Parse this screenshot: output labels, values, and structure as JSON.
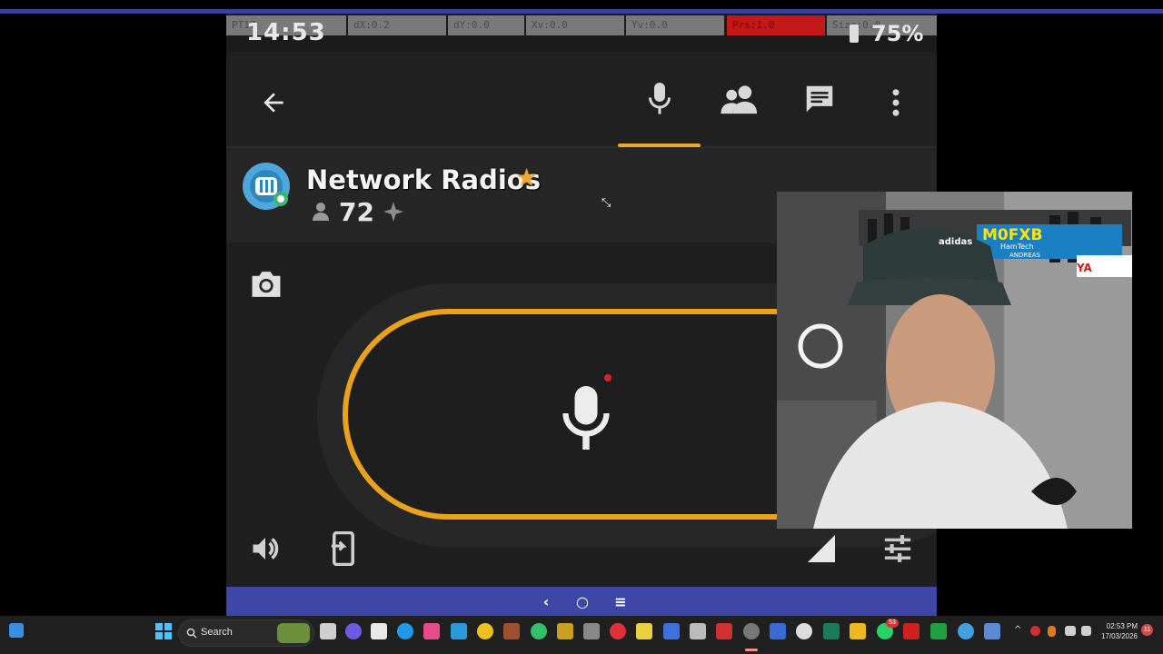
{
  "status_bar": {
    "time": "14:53",
    "battery": "75%",
    "cells": [
      "PT17",
      "dX:0.2",
      "dY:0.0",
      "Xv:0.0",
      "Yv:0.0",
      "Prs:1.0",
      "Size:0.0"
    ]
  },
  "app_bar": {
    "back_icon": "arrow-left-icon",
    "mic_tab_icon": "microphone-icon",
    "users_tab_icon": "people-icon",
    "chat_tab_icon": "chat-icon",
    "more_icon": "more-vert-icon",
    "active_tab": "microphone"
  },
  "channel": {
    "name": "Network Radios",
    "members": "72",
    "favorite": true
  },
  "controls": {
    "camera_icon": "camera-icon",
    "ptt_icon": "microphone-icon",
    "speaker_icon": "speaker-icon",
    "device_icon": "device-icon",
    "signal_icon": "signal-icon",
    "settings_icon": "sliders-icon"
  },
  "nav_bar": {
    "back": "‹",
    "home": "○",
    "menu": "≡"
  },
  "webcam": {
    "sign_text": "M0FXB",
    "sign_sub": "HamTech",
    "sign_sub2": "ANDREAS",
    "cap_text": "adidas"
  },
  "taskbar": {
    "search_placeholder": "Search",
    "time": "02:53 PM",
    "date": "17/03/2026",
    "whatsapp_badge": "53",
    "notification_badge": "11"
  },
  "colors": {
    "accent": "#f0a826",
    "nav_bar": "#3f47a6",
    "status_red": "#e01818"
  }
}
